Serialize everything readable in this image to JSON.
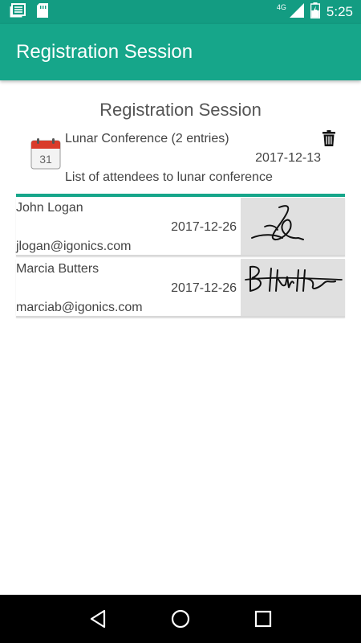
{
  "status_bar": {
    "time": "5:25",
    "network_type": "4G",
    "icons": [
      "notes-icon",
      "sim-card-icon",
      "signal-icon",
      "battery-charging-icon"
    ]
  },
  "app_bar": {
    "title": "Registration Session"
  },
  "session": {
    "heading": "Registration Session",
    "name": "Lunar Conference (2 entries)",
    "date": "2017-12-13",
    "description": "List of attendees to lunar conference",
    "calendar_day": "31"
  },
  "entries": [
    {
      "name": "John Logan",
      "date": "2017-12-26",
      "email": "jlogan@igonics.com"
    },
    {
      "name": "Marcia Butters",
      "date": "2017-12-26",
      "email": "marciab@igonics.com"
    }
  ],
  "colors": {
    "status_bar": "#139C82",
    "app_bar": "#16A68A",
    "accent_divider": "#16A68A",
    "signature_bg": "#e0e0e0"
  },
  "nav": [
    "back-icon",
    "home-icon",
    "recents-icon"
  ]
}
